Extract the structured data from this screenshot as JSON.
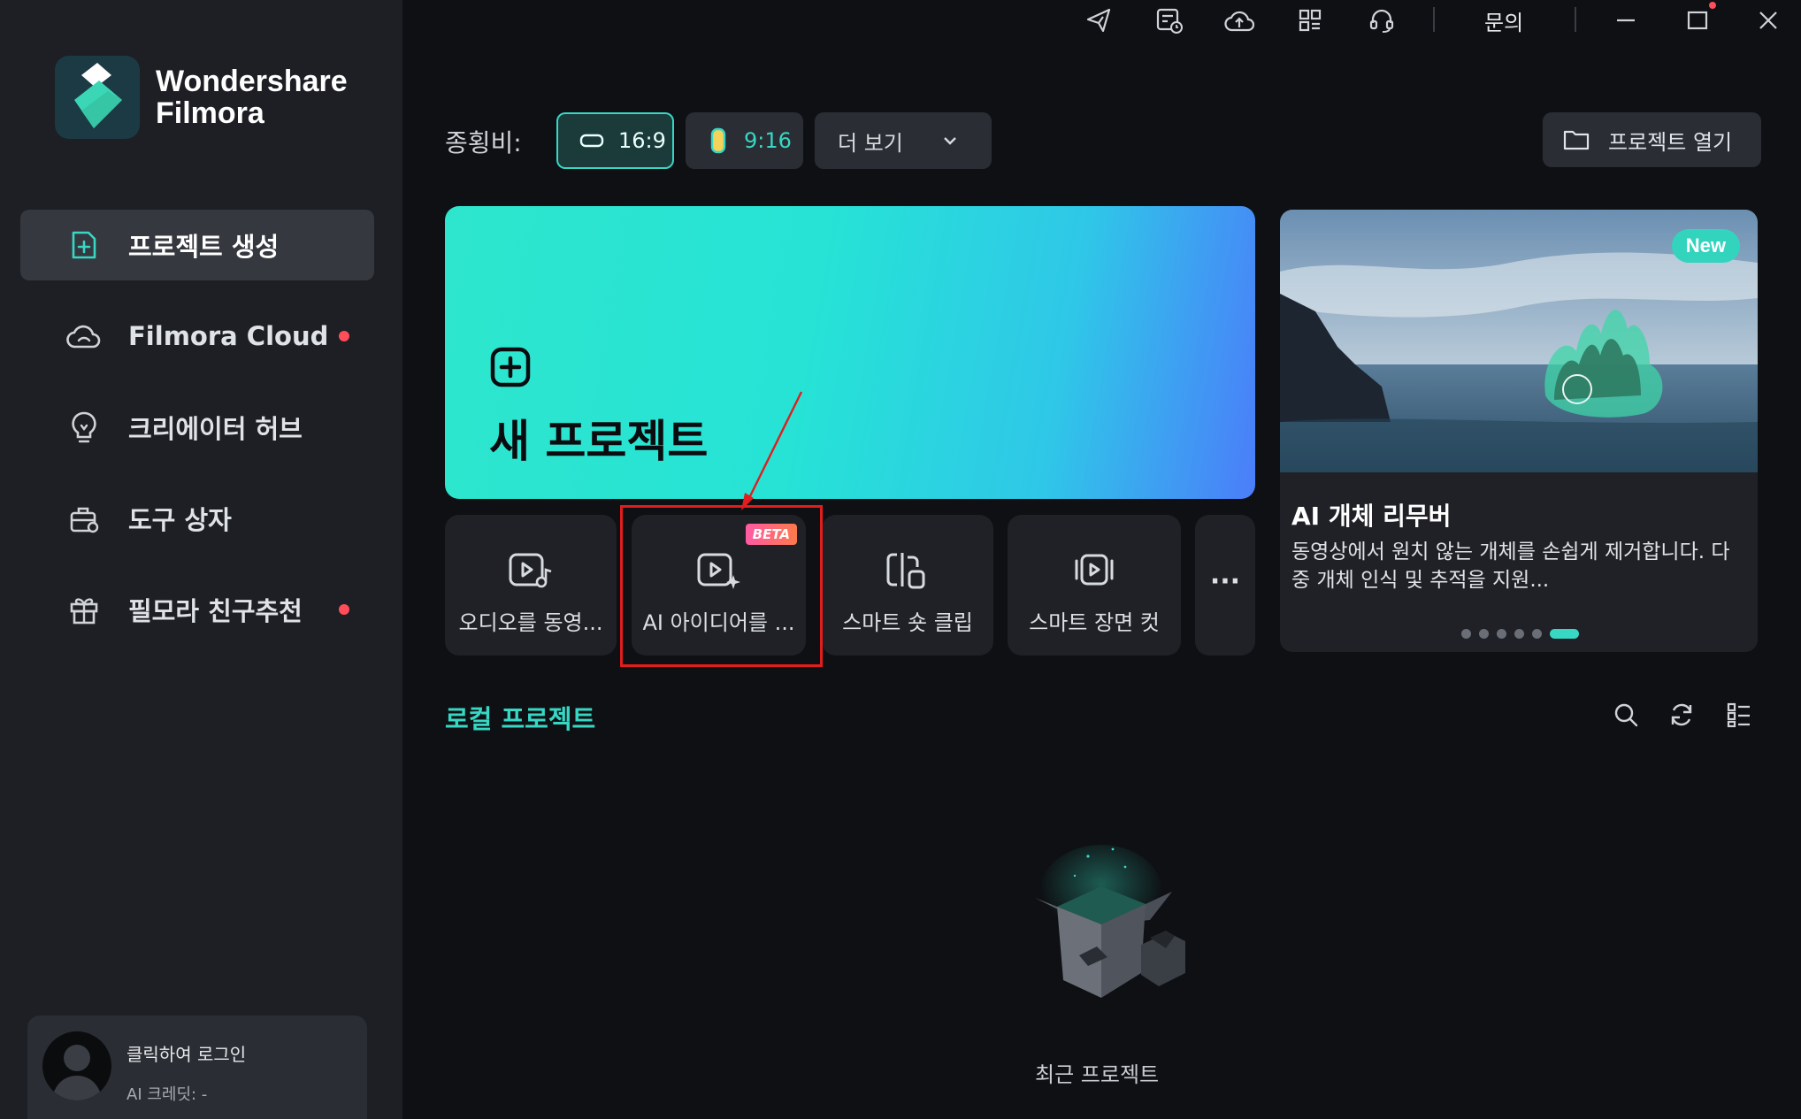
{
  "app": {
    "brand_line1": "Wondershare",
    "brand_line2": "Filmora",
    "accent": "#37d7c4"
  },
  "titlebar": {
    "icons": [
      "send-icon",
      "schedule-icon",
      "cloud-upload-icon",
      "grid-apps-icon",
      "headset-icon"
    ],
    "inquiry_label": "문의",
    "window_controls": [
      "minimize-icon",
      "maximize-icon",
      "close-icon"
    ]
  },
  "sidebar": {
    "items": [
      {
        "label": "프로젝트 생성",
        "icon": "new-project-icon",
        "active": true,
        "dot": false
      },
      {
        "label": "Filmora Cloud",
        "icon": "cloud-icon",
        "active": false,
        "dot": true
      },
      {
        "label": "크리에이터 허브",
        "icon": "bulb-icon",
        "active": false,
        "dot": false
      },
      {
        "label": "도구 상자",
        "icon": "toolbox-icon",
        "active": false,
        "dot": false
      },
      {
        "label": "필모라 친구추천",
        "icon": "gift-icon",
        "active": false,
        "dot": true
      }
    ],
    "user": {
      "login_text": "클릭하여 로그인",
      "credit_text": "AI 크레딧: -"
    }
  },
  "ratio": {
    "label": "종횡비:",
    "options": [
      {
        "label": "16:9",
        "active": true
      },
      {
        "label": "9:16",
        "active": false
      }
    ],
    "more_label": "더 보기",
    "open_project_label": "프로젝트 열기"
  },
  "new_project": {
    "title": "새 프로젝트"
  },
  "features": [
    {
      "label": "오디오를 동영...",
      "icon": "audio-to-video-icon",
      "beta": false
    },
    {
      "label": "AI 아이디어를 ...",
      "icon": "ai-idea-video-icon",
      "beta": true,
      "beta_label": "BETA"
    },
    {
      "label": "스마트 숏 클립",
      "icon": "smart-short-clip-icon",
      "beta": false
    },
    {
      "label": "스마트 장면 컷",
      "icon": "smart-scene-cut-icon",
      "beta": false
    }
  ],
  "more_features_label": "···",
  "promo": {
    "badge": "New",
    "title": "AI 개체 리무버",
    "desc": "동영상에서 원치 않는 개체를 손쉽게 제거합니다. 다중 개체 인식 및 추적을 지원...",
    "slide_count": 6,
    "active_slide": 6
  },
  "local": {
    "title": "로컬 프로젝트",
    "icons": [
      "search-icon",
      "refresh-icon",
      "list-view-icon"
    ],
    "empty_label": "최근 프로젝트"
  }
}
